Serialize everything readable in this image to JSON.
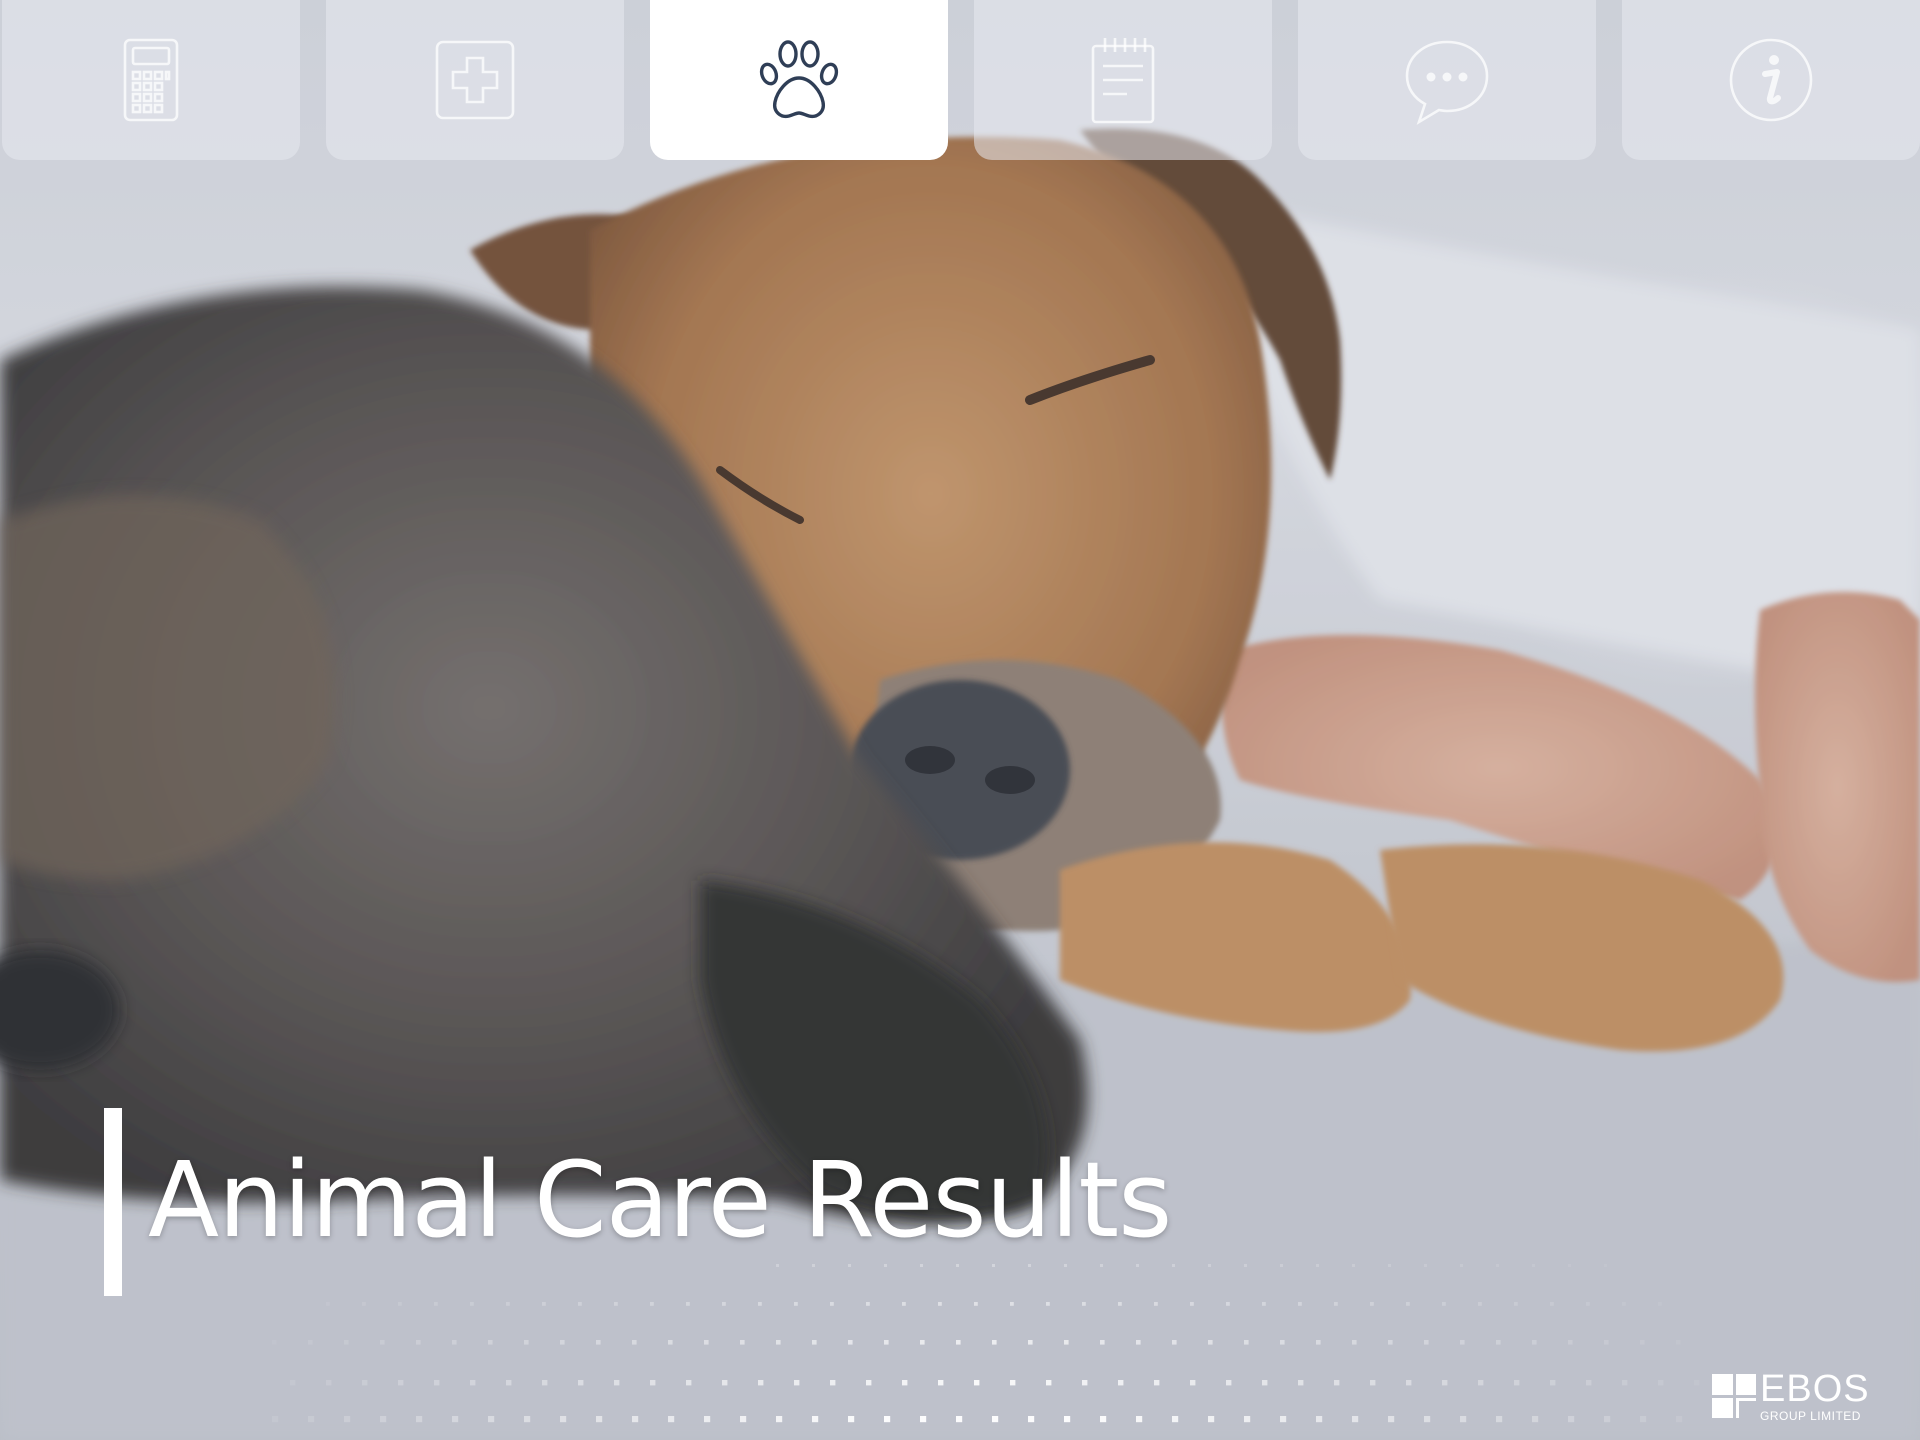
{
  "nav": {
    "tabs": [
      {
        "icon": "calculator-icon",
        "active": false
      },
      {
        "icon": "medical-cross-icon",
        "active": false
      },
      {
        "icon": "paw-print-icon",
        "active": true
      },
      {
        "icon": "notepad-icon",
        "active": false
      },
      {
        "icon": "chat-bubble-icon",
        "active": false
      },
      {
        "icon": "info-icon",
        "active": false
      }
    ]
  },
  "hero": {
    "title": "Animal Care Results",
    "image": "dogs-sleeping-photo"
  },
  "logo": {
    "name": "EBOS",
    "subtitle": "GROUP LIMITED"
  },
  "colors": {
    "active_tile": "#ffffff",
    "icon_active": "#2f3e56",
    "icon_inactive": "#ffffff",
    "title_text": "#ffffff"
  }
}
